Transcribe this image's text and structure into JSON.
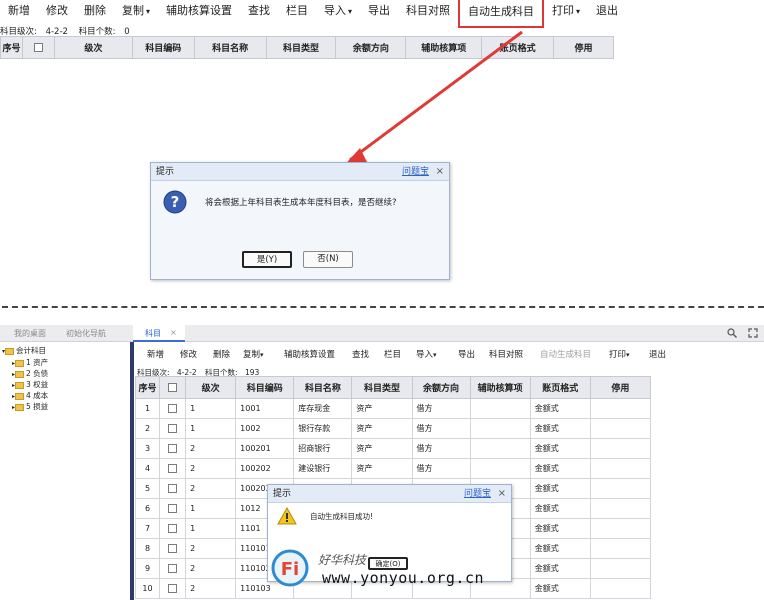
{
  "top": {
    "toolbar": [
      {
        "label": "新增"
      },
      {
        "label": "修改"
      },
      {
        "label": "删除"
      },
      {
        "label": "复制",
        "caret": true
      },
      {
        "label": "辅助核算设置"
      },
      {
        "label": "查找"
      },
      {
        "label": "栏目"
      },
      {
        "label": "导入",
        "caret": true
      },
      {
        "label": "导出"
      },
      {
        "label": "科目对照"
      },
      {
        "label": "自动生成科目",
        "highlighted": true
      },
      {
        "label": "打印",
        "caret": true
      },
      {
        "label": "退出"
      }
    ],
    "status": {
      "level_label": "科目级次:",
      "level_value": "4-2-2",
      "count_label": "科目个数:",
      "count_value": "0"
    },
    "columns": [
      "序号",
      "",
      "级次",
      "科目编码",
      "科目名称",
      "科目类型",
      "余额方向",
      "辅助核算项",
      "账页格式",
      "停用"
    ]
  },
  "dialog1": {
    "title": "提示",
    "help": "问题宝",
    "close": "×",
    "message": "将会根据上年科目表生成本年度科目表，是否继续?",
    "yes": "是(Y)",
    "no": "否(N)",
    "icon": "question-icon"
  },
  "bottom": {
    "tabs": [
      "我的桌面",
      "初始化导航",
      "科目"
    ],
    "tab_close": "×",
    "tree": {
      "root": "会计科目",
      "children": [
        "1 资产",
        "2 负债",
        "3 权益",
        "4 成本",
        "5 损益"
      ]
    },
    "toolbar": [
      {
        "label": "新增"
      },
      {
        "label": "修改"
      },
      {
        "label": "删除"
      },
      {
        "label": "复制",
        "caret": true
      },
      {
        "label": "辅助核算设置"
      },
      {
        "label": "查找"
      },
      {
        "label": "栏目"
      },
      {
        "label": "导入",
        "caret": true
      },
      {
        "label": "导出"
      },
      {
        "label": "科目对照"
      },
      {
        "label": "自动生成科目",
        "disabled": true
      },
      {
        "label": "打印",
        "caret": true
      },
      {
        "label": "退出"
      }
    ],
    "status": {
      "level_label": "科目级次:",
      "level_value": "4-2-2",
      "count_label": "科目个数:",
      "count_value": "193"
    },
    "columns": [
      "序号",
      "",
      "级次",
      "科目编码",
      "科目名称",
      "科目类型",
      "余额方向",
      "辅助核算项",
      "账页格式",
      "停用"
    ],
    "rows": [
      {
        "no": "1",
        "level": "1",
        "code": "1001",
        "name": "库存现金",
        "type": "资产",
        "dir": "借方",
        "aux": "",
        "fmt": "金额式",
        "stop": ""
      },
      {
        "no": "2",
        "level": "1",
        "code": "1002",
        "name": "银行存款",
        "type": "资产",
        "dir": "借方",
        "aux": "",
        "fmt": "金额式",
        "stop": ""
      },
      {
        "no": "3",
        "level": "2",
        "code": "100201",
        "name": "招商银行",
        "type": "资产",
        "dir": "借方",
        "aux": "",
        "fmt": "金额式",
        "stop": ""
      },
      {
        "no": "4",
        "level": "2",
        "code": "100202",
        "name": "建设银行",
        "type": "资产",
        "dir": "借方",
        "aux": "",
        "fmt": "金额式",
        "stop": ""
      },
      {
        "no": "5",
        "level": "2",
        "code": "100203",
        "name": "",
        "type": "",
        "dir": "",
        "aux": "",
        "fmt": "金额式",
        "stop": ""
      },
      {
        "no": "6",
        "level": "1",
        "code": "1012",
        "name": "",
        "type": "",
        "dir": "",
        "aux": "",
        "fmt": "金额式",
        "stop": ""
      },
      {
        "no": "7",
        "level": "1",
        "code": "1101",
        "name": "",
        "type": "",
        "dir": "",
        "aux": "",
        "fmt": "金额式",
        "stop": ""
      },
      {
        "no": "8",
        "level": "2",
        "code": "110101",
        "name": "",
        "type": "",
        "dir": "",
        "aux": "",
        "fmt": "金额式",
        "stop": ""
      },
      {
        "no": "9",
        "level": "2",
        "code": "110102",
        "name": "",
        "type": "",
        "dir": "",
        "aux": "",
        "fmt": "金额式",
        "stop": ""
      },
      {
        "no": "10",
        "level": "2",
        "code": "110103",
        "name": "",
        "type": "",
        "dir": "",
        "aux": "",
        "fmt": "金额式",
        "stop": ""
      }
    ],
    "dialog2": {
      "title": "提示",
      "help": "问题宝",
      "close": "×",
      "message": "自动生成科目成功!",
      "ok": "确定(O)",
      "icon": "warning-icon"
    }
  },
  "watermark": {
    "brand": "好华科技",
    "url": "www.yonyou.org.cn"
  },
  "colors": {
    "highlight_border": "#d9373a",
    "arrow": "#e03a36",
    "header_bg": "#e8e9ee",
    "link": "#2b63c8",
    "splitter": "#2e3a6b"
  }
}
